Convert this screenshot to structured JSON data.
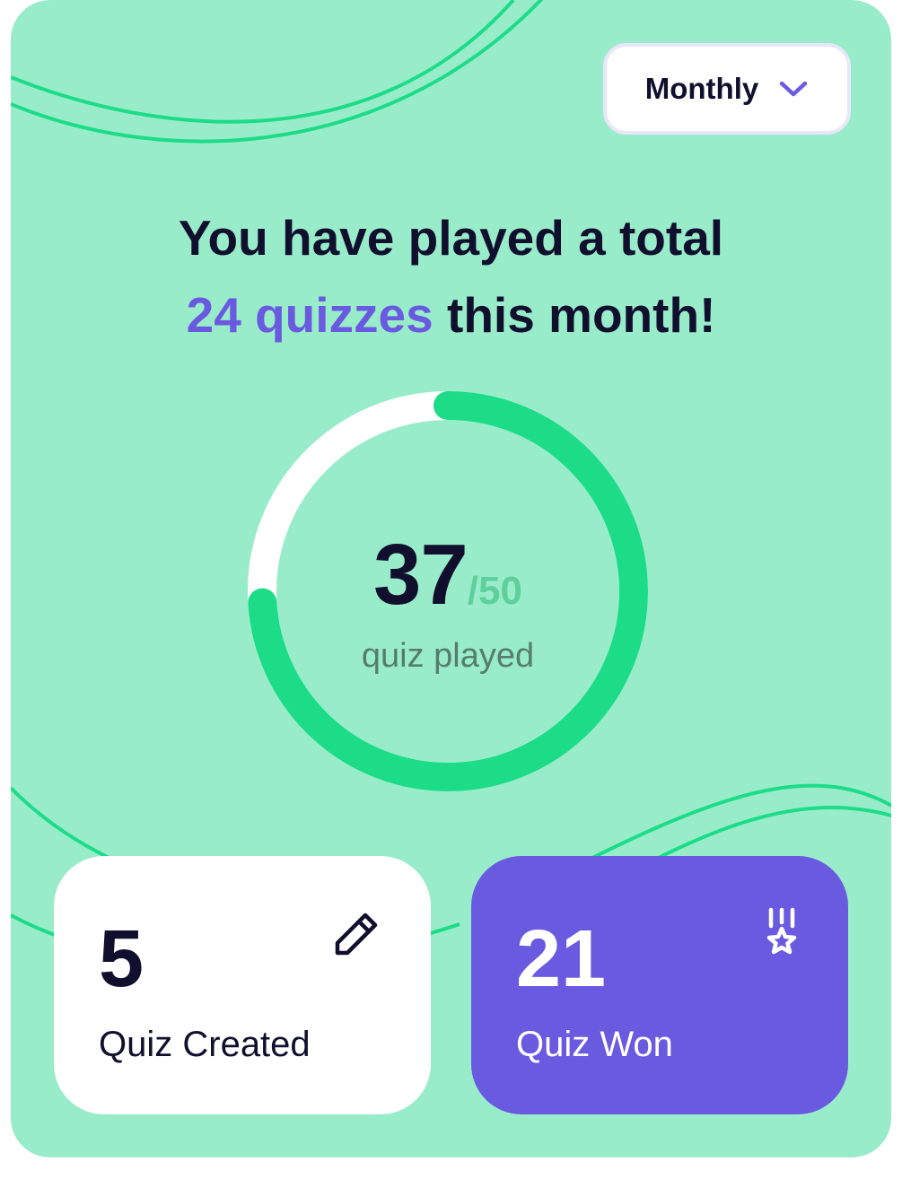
{
  "period_filter": {
    "label": "Monthly",
    "icon": "chevron-down-icon"
  },
  "headline": {
    "line1": "You have played a total",
    "highlight": "24 quizzes",
    "line2_suffix": " this month!"
  },
  "progress": {
    "played": "37",
    "total": "/50",
    "caption": "quiz played",
    "fraction": 0.74
  },
  "stats": {
    "created": {
      "value": "5",
      "label": "Quiz Created",
      "icon": "pencil-icon"
    },
    "won": {
      "value": "21",
      "label": "Quiz Won",
      "icon": "medal-icon"
    }
  },
  "colors": {
    "card_bg": "#99ecca",
    "accent_green": "#1ddc88",
    "accent_purple": "#6a5ae0",
    "ink": "#10102e"
  }
}
